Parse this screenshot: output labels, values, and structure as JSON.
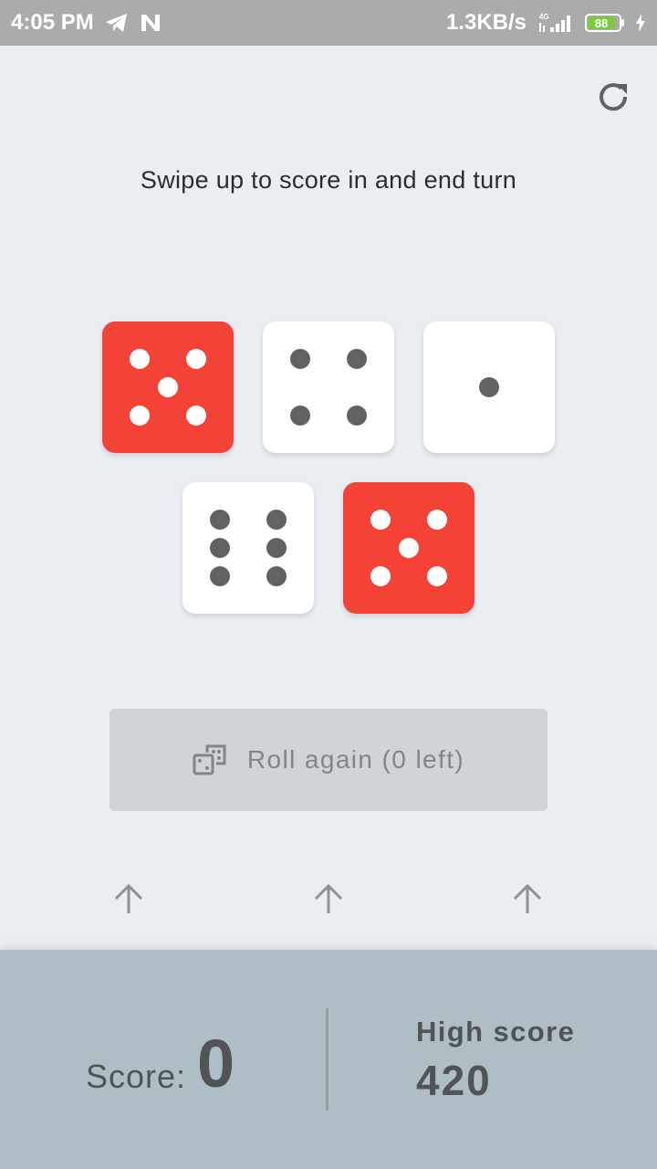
{
  "status_bar": {
    "time": "4:05 PM",
    "speed": "1.3KB/s",
    "network": "4G",
    "battery": "88",
    "icons": [
      "telegram-icon",
      "notification-n-icon",
      "signal-icon",
      "battery-icon",
      "charging-icon"
    ]
  },
  "instruction": "Swipe up to score in and end turn",
  "dice": [
    {
      "value": 5,
      "color": "red"
    },
    {
      "value": 4,
      "color": "white"
    },
    {
      "value": 1,
      "color": "white"
    },
    {
      "value": 6,
      "color": "white"
    },
    {
      "value": 5,
      "color": "red"
    }
  ],
  "roll_button": {
    "label": "Roll again (0 left)",
    "icon": "dice-icon",
    "enabled": false
  },
  "swipe_arrows": [
    "arrow-up-icon",
    "arrow-up-icon",
    "arrow-up-icon"
  ],
  "score": {
    "label": "Score:",
    "value": "0",
    "high_label": "High score",
    "high_value": "420"
  },
  "colors": {
    "accent_red": "#f44336",
    "die_white": "#ffffff",
    "pip_gray": "#626262",
    "panel": "#afbec5",
    "background": "#eaeef2"
  }
}
